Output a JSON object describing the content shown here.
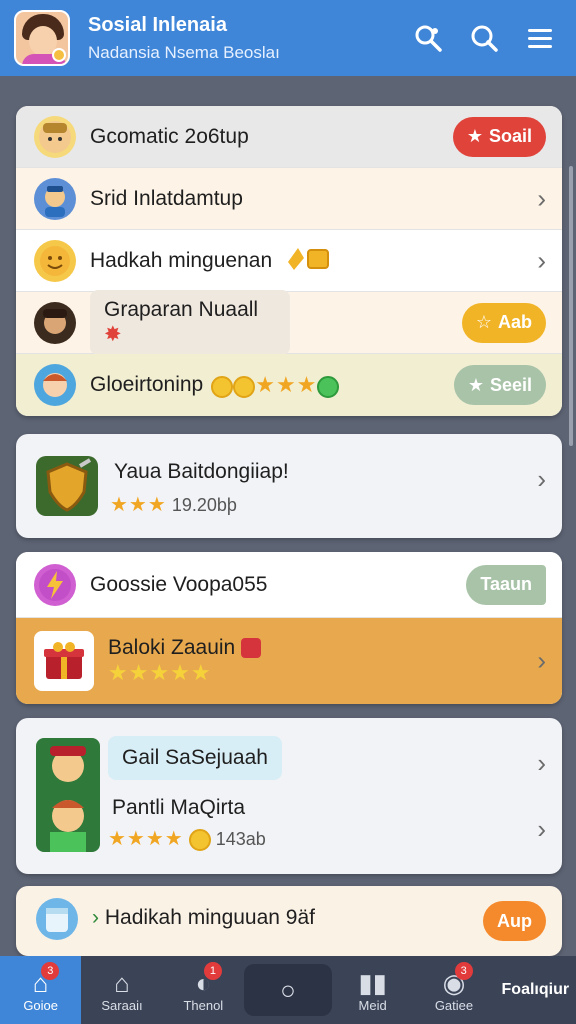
{
  "header": {
    "title": "Sosial Inlenaia",
    "subtitle": "Nadansia Nsema Beoslaı"
  },
  "card1": {
    "rows": [
      {
        "label": "Gcomatic 2o6tup",
        "pill": "Soail",
        "pill_color": "#e0433a"
      },
      {
        "label": "Srid Inlatdamtup"
      },
      {
        "label": "Hadkah minguenan"
      },
      {
        "label": "Graparan Nuaall",
        "pill": "Aab",
        "pill_color": "#f2b427"
      },
      {
        "label": "Gloeirtoninp",
        "pill": "Seeil",
        "pill_color": "#a8c3a8"
      }
    ]
  },
  "card2": {
    "title": "Yaua Baitdongiiap!",
    "meta": "19.20bþ",
    "rating": 3
  },
  "card3": {
    "row1": {
      "label": "Goossie  Voopa055",
      "pill": "Taaun"
    },
    "row2": {
      "label": "Baloki Zaauin",
      "rating": 5
    }
  },
  "card4": {
    "row1": "Gail SaSejuaah",
    "row2": "Pantli MaQirta",
    "meta": "143ab",
    "rating": 4
  },
  "card5": {
    "label": "Hadikah minguuan 9äf",
    "pill": "Aup"
  },
  "nav": {
    "tabs": [
      {
        "label": "Goioe",
        "badge": "3"
      },
      {
        "label": "Saraaiı",
        "badge": ""
      },
      {
        "label": "Thenol",
        "badge": "1"
      },
      {
        "label": "",
        "badge": ""
      },
      {
        "label": "Meid",
        "badge": ""
      },
      {
        "label": "Gatiee",
        "badge": "3"
      },
      {
        "label": "Foalıqiur",
        "badge": ""
      }
    ]
  },
  "colors": {
    "accent": "#3f86d8",
    "background": "#5d6474",
    "nav": "#3b4457"
  }
}
